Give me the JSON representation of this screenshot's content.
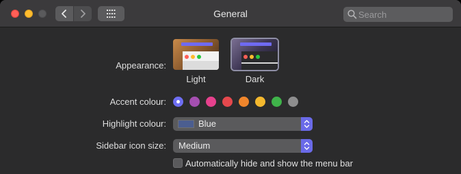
{
  "window": {
    "title": "General"
  },
  "search": {
    "placeholder": "Search"
  },
  "appearance": {
    "label": "Appearance:",
    "options": [
      {
        "label": "Light",
        "selected": false
      },
      {
        "label": "Dark",
        "selected": true
      }
    ]
  },
  "accent": {
    "label": "Accent colour:",
    "colors": [
      "#6e6ef2",
      "#a54fb1",
      "#e6418d",
      "#e5484d",
      "#f0862c",
      "#f4b82e",
      "#3fb34a",
      "#8e8e8f"
    ],
    "selected_index": 0
  },
  "highlight": {
    "label": "Highlight colour:",
    "value": "Blue",
    "swatch_color": "#4b5e90"
  },
  "sidebar_icon_size": {
    "label": "Sidebar icon size:",
    "value": "Medium"
  },
  "menu_bar": {
    "label": "Automatically hide and show the menu bar",
    "checked": false
  },
  "icons": {
    "back": "chevron-left-icon",
    "forward": "chevron-right-icon",
    "grid": "grid-icon",
    "search": "search-icon",
    "stepper": "up-down-chevron-icon"
  }
}
